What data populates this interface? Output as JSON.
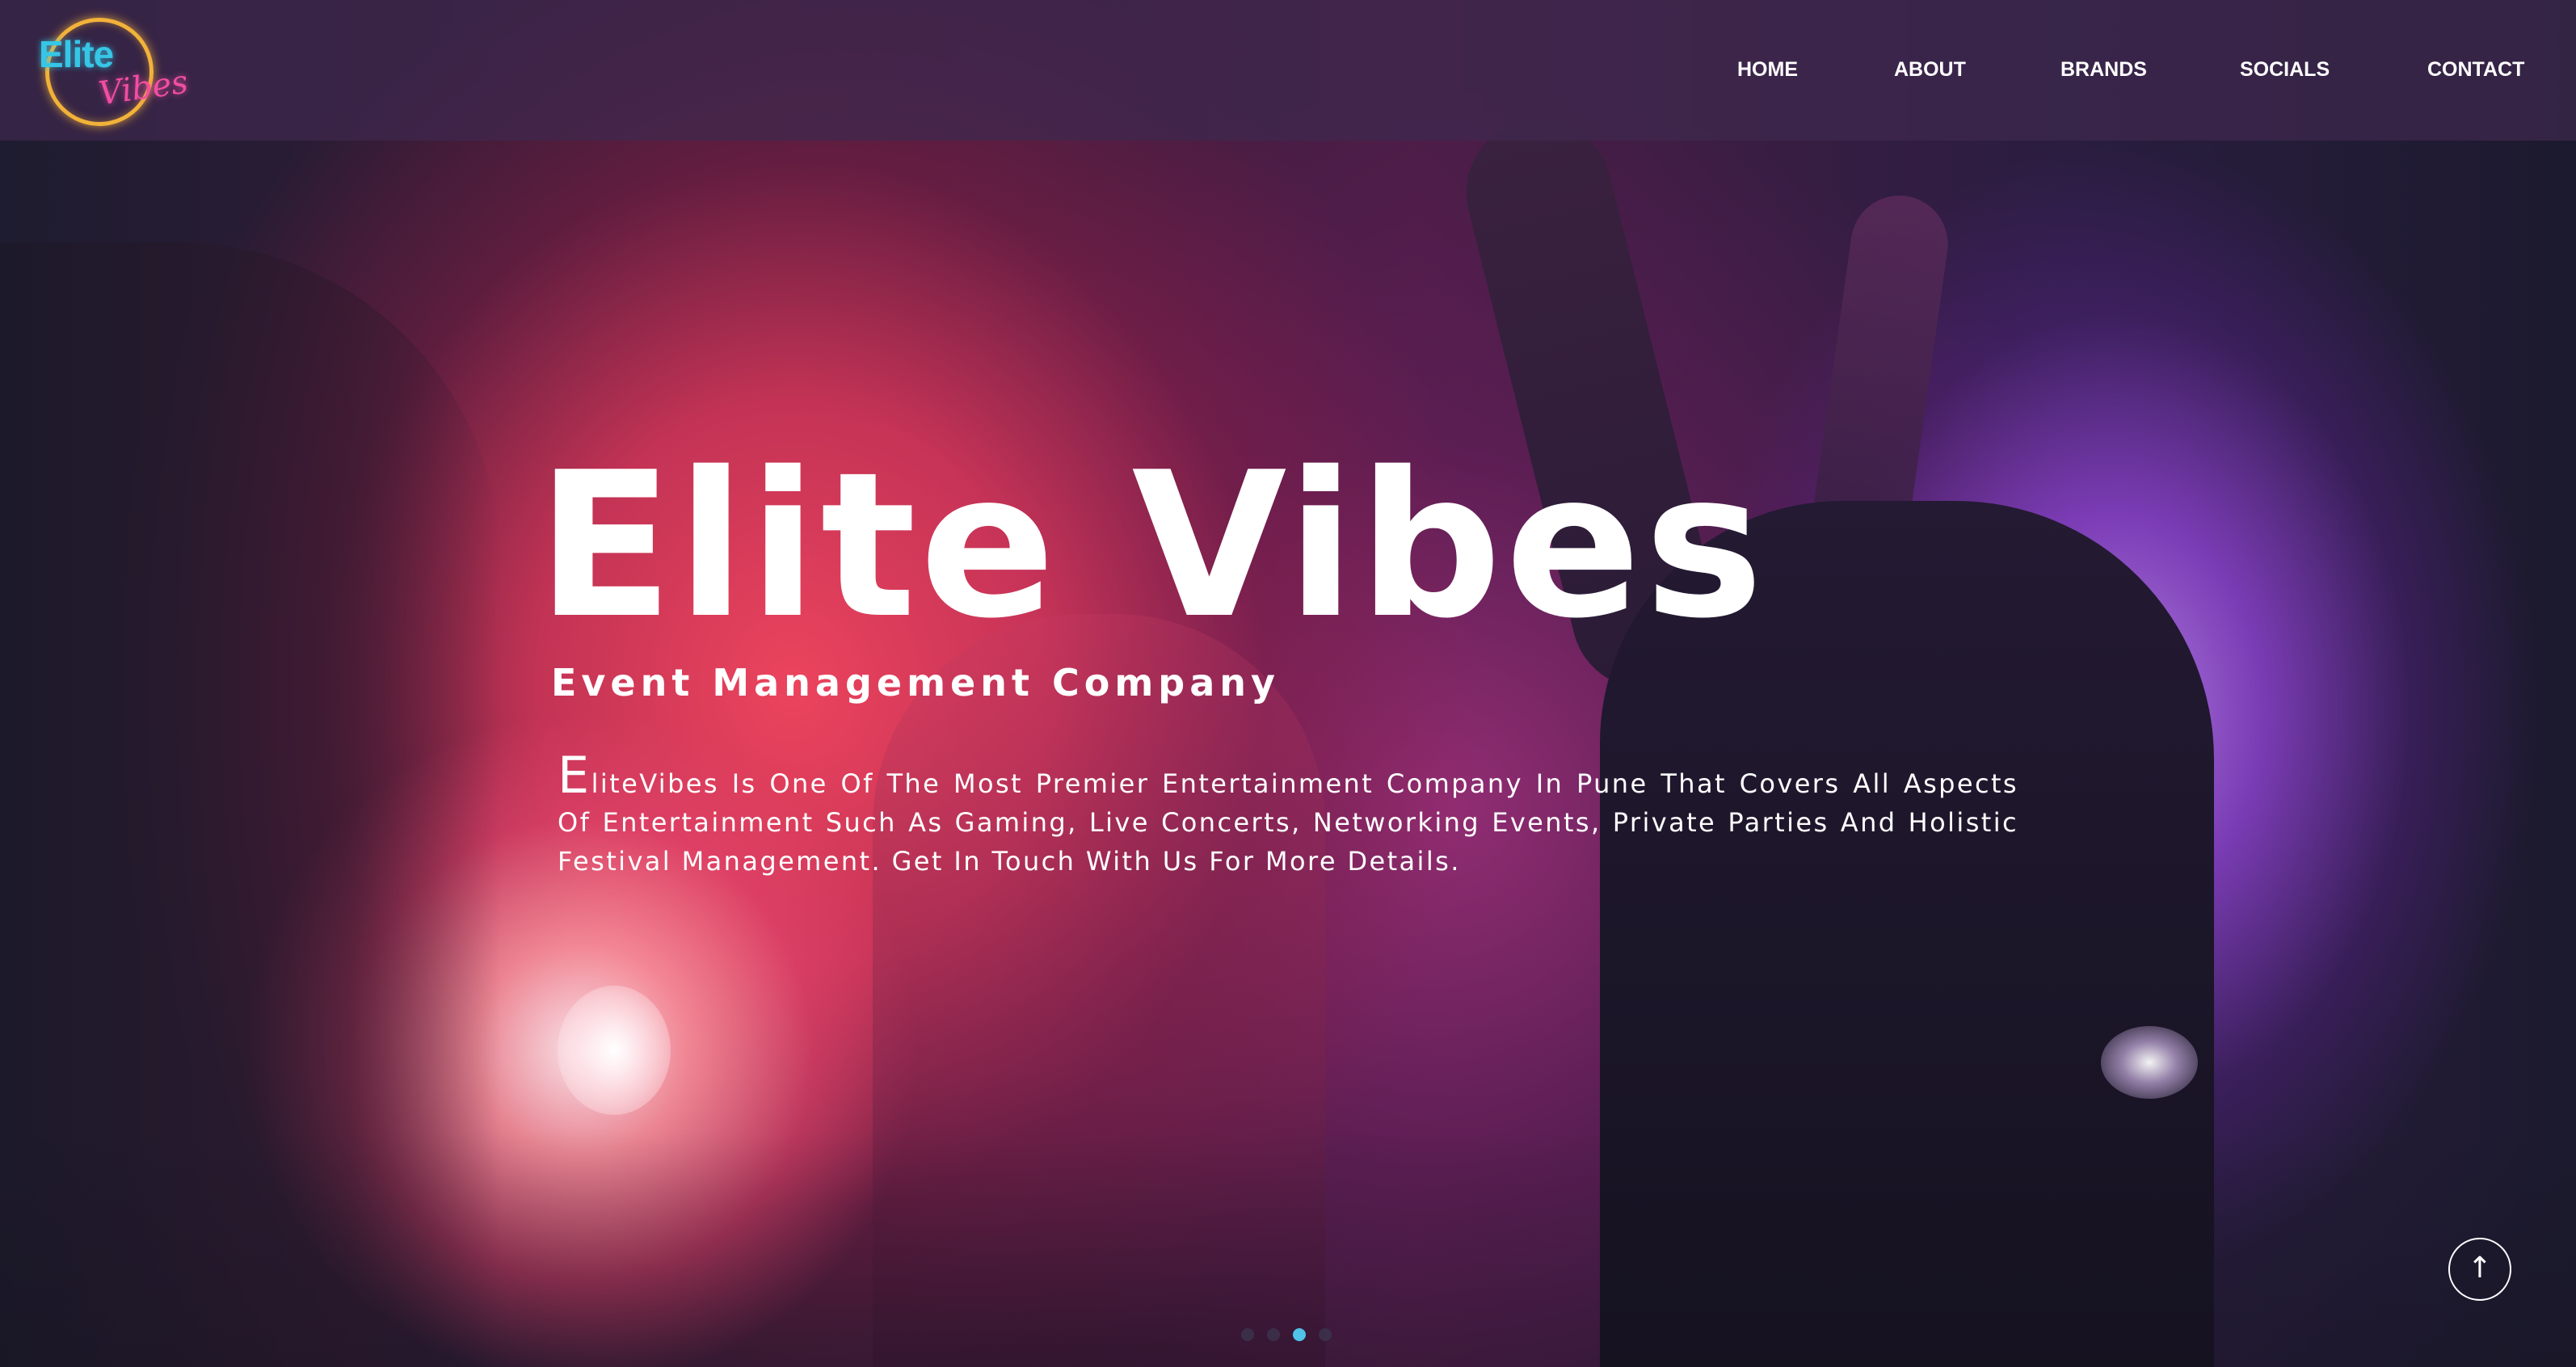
{
  "brand": {
    "logo_word1": "Elite",
    "logo_word2": "Vibes",
    "ring_color": "#f2b23a",
    "word1_color": "#36c6e6",
    "word2_color": "#f14ea3"
  },
  "nav": {
    "items": [
      {
        "label": "HOME"
      },
      {
        "label": "ABOUT"
      },
      {
        "label": "BRANDS"
      },
      {
        "label": "SOCIALS"
      },
      {
        "label": "CONTACT"
      }
    ]
  },
  "hero": {
    "title": "Elite Vibes",
    "subtitle": "Event Management Company",
    "desc_dropcap": "E",
    "desc_rest": "liteVibes Is One Of The Most Premier Entertainment Company In Pune That Covers All Aspects Of Entertainment Such As Gaming, Live Concerts, Networking Events, Private Parties And Holistic Festival Management. Get In Touch With Us For More Details.",
    "background_image": "crowd-concert-photo"
  },
  "carousel": {
    "slide_count": 4,
    "active_index": 2,
    "active_color": "#4fc3e8"
  },
  "scroll_top": {
    "icon": "arrow-up-icon",
    "glyph": "↑"
  }
}
